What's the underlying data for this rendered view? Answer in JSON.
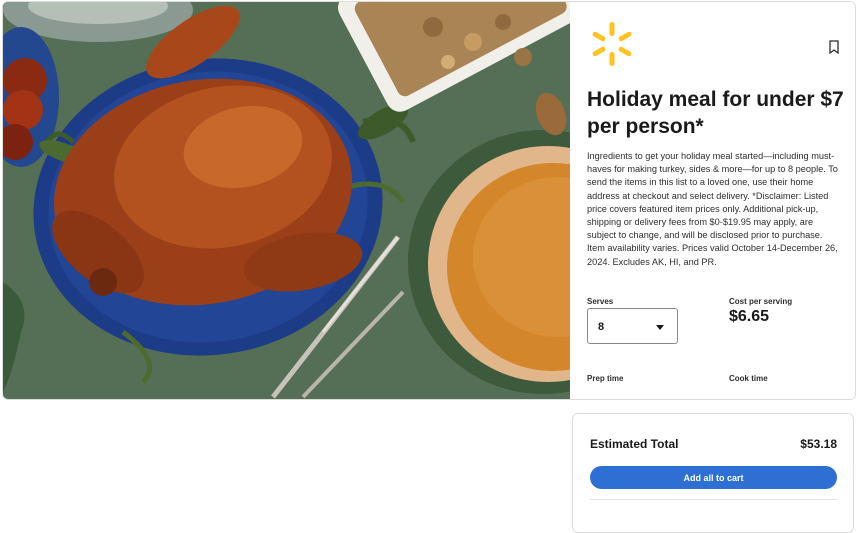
{
  "hero": {
    "image_description_icon": "holiday-turkey-dinner-image",
    "colors": {
      "background": "#546f55",
      "platter": "#1f3f8a",
      "turkey": "#a3471c",
      "pie": "#d4862a"
    }
  },
  "brand": {
    "logo_icon": "walmart-spark-icon",
    "color": "#ffc220"
  },
  "recipe": {
    "title": "Holiday meal for under $7 per person*",
    "description": "Ingredients to get your holiday meal started—including must-haves for making turkey, sides & more—for up to 8 people. To send the items in this list to a loved one, use their home address at checkout and select delivery. *Disclaimer: Listed price covers featured item prices only. Additional pick-up, shipping or delivery fees from $0-$19.95 may apply, are subject to change, and will be disclosed prior to purchase. Item availability varies. Prices valid October 14-December 26, 2024. Excludes AK, HI, and PR.",
    "serves_label": "Serves",
    "serves_value": "8",
    "cost_label": "Cost per serving",
    "cost_value": "$6.65",
    "prep_label": "Prep time",
    "cook_label": "Cook time",
    "bookmark_icon": "bookmark-icon"
  },
  "cart": {
    "total_label": "Estimated Total",
    "total_value": "$53.18",
    "add_button_label": "Add all to cart",
    "button_color": "#2e6fd4"
  }
}
